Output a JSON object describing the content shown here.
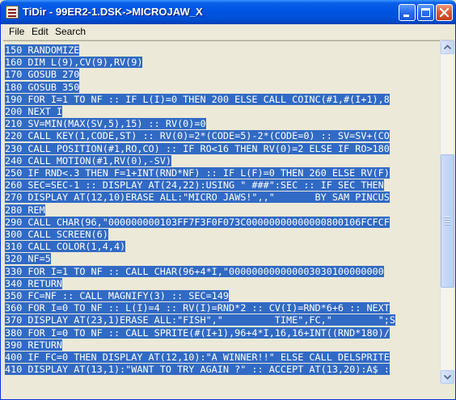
{
  "window": {
    "title": "TiDir - 99ER2-1.DSK->MICROJAW_X",
    "icon": "tidir-app-icon",
    "controls": [
      "minimize-icon",
      "maximize-icon",
      "close-icon"
    ]
  },
  "menu": {
    "items": [
      "File",
      "Edit",
      "Search"
    ]
  },
  "code": {
    "selection_color": "#316ac5",
    "lines": [
      "150 RANDOMIZE",
      "160 DIM L(9),CV(9),RV(9)",
      "170 GOSUB 270",
      "180 GOSUB 350",
      "190 FOR I=1 TO NF :: IF L(I)=0 THEN 200 ELSE CALL COINC(#1,#(I+1),8",
      "200 NEXT I",
      "210 SV=MIN(MAX(SV,5),15) :: RV(0)=0",
      "220 CALL KEY(1,CODE,ST) :: RV(0)=2*(CODE=5)-2*(CODE=0) :: SV=SV+(CO",
      "230 CALL POSITION(#1,RO,CO) :: IF RO<16 THEN RV(0)=2 ELSE IF RO>180",
      "240 CALL MOTION(#1,RV(0),-SV)",
      "250 IF RND<.3 THEN F=1+INT(RND*NF) :: IF L(F)=0 THEN 260 ELSE RV(F)",
      "260 SEC=SEC-1 :: DISPLAY AT(24,22):USING \" ###\":SEC :: IF SEC THEN",
      "270 DISPLAY AT(12,10)ERASE ALL:\"MICRO JAWS!\",,\"       BY SAM PINCUS",
      "280 REM",
      "290 CALL CHAR(96,\"000000000103FF7F3F0F073C00000000000000800106FCFCF",
      "300 CALL SCREEN(6)",
      "310 CALL COLOR(1,4,4)",
      "320 NF=5",
      "330 FOR I=1 TO NF :: CALL CHAR(96+4*I,\"000000000000003030100000000",
      "340 RETURN",
      "350 FC=NF :: CALL MAGNIFY(3) :: SEC=149",
      "360 FOR I=0 TO NF :: L(I)=4 :: RV(I)=RND*2 :: CV(I)=RND*6+6 :: NEXT",
      "370 DISPLAY AT(23,1)ERASE ALL:\"FISH\",\"         TIME\",FC,\"        \";S",
      "380 FOR I=0 TO NF :: CALL SPRITE(#(I+1),96+4*I,16,16+INT((RND*180)/",
      "390 RETURN",
      "400 IF FC=0 THEN DISPLAY AT(12,10):\"A WINNER!!\" ELSE CALL DELSPRITE",
      "410 DISPLAY AT(13,1):\"WANT TO TRY AGAIN ?\" :: ACCEPT AT(13,20):A$ :"
    ]
  },
  "scrollbar": {
    "up_icon": "scroll-up-arrow-icon",
    "down_icon": "scroll-down-arrow-icon",
    "position": 0.55
  }
}
